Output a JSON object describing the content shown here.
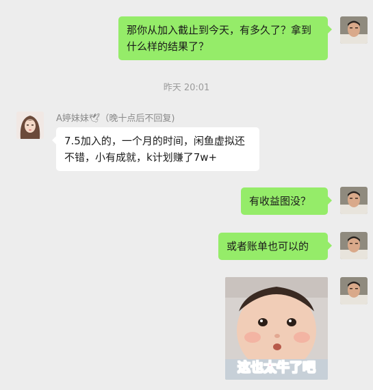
{
  "timestamp": "昨天 20:01",
  "contact": {
    "display_name": "A婷妹妹🕊（晚十点后不回复)"
  },
  "messages": [
    {
      "sender": "self",
      "text": "那你从加入截止到今天，有多久了？拿到什么样的结果了？"
    },
    {
      "sender": "other",
      "text": "7.5加入的，一个月的时间，闲鱼虚拟还不错，小有成就，k计划赚了7w+"
    },
    {
      "sender": "self",
      "text": "有收益图没？"
    },
    {
      "sender": "self",
      "text": "或者账单也可以的"
    },
    {
      "sender": "self",
      "type": "sticker",
      "caption": "这也太牛了吧"
    }
  ],
  "colors": {
    "background": "#ededed",
    "self_bubble": "#95ec69",
    "other_bubble": "#ffffff",
    "sticker_caption": "#ff4fa0"
  }
}
